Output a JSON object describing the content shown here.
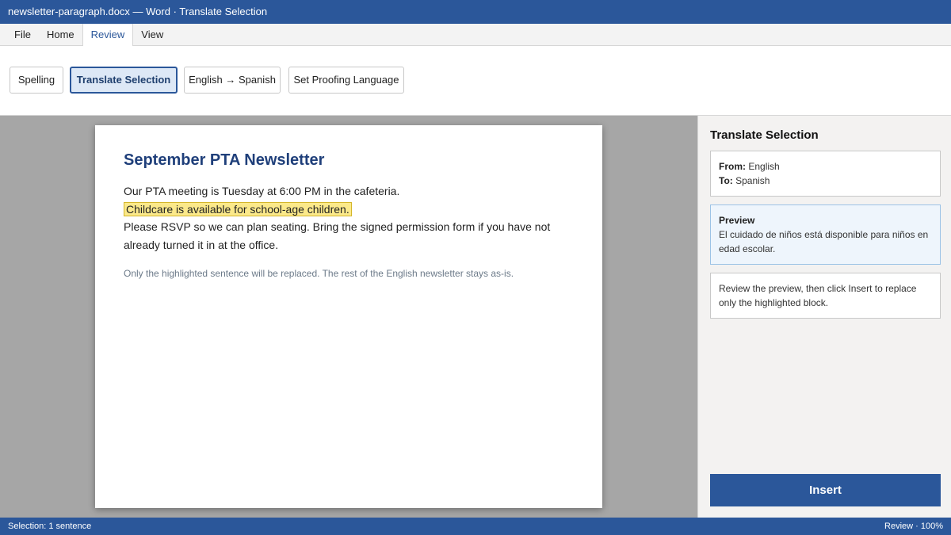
{
  "window": {
    "title": "newsletter-paragraph.docx — Word · Translate Selection"
  },
  "menu": {
    "tabs": [
      {
        "label": "File"
      },
      {
        "label": "Home"
      },
      {
        "label": "Review",
        "active": true
      },
      {
        "label": "View"
      }
    ]
  },
  "ribbon": {
    "spelling": "Spelling",
    "translate_selection": "Translate Selection",
    "language_pair": "English → Spanish",
    "set_proofing": "Set Proofing Language"
  },
  "document": {
    "title": "September PTA Newsletter",
    "line1": "Our PTA meeting is Tuesday at 6:00 PM in the cafeteria.",
    "highlighted": "Childcare is available for school-age children.",
    "line3": "Please RSVP so we can plan seating. Bring the signed permission form if you have not already turned it in at the office.",
    "note": "Only the highlighted sentence will be replaced. The rest of the English newsletter stays as-is."
  },
  "panel": {
    "title": "Translate Selection",
    "from_label": "From:",
    "from_value": "English",
    "to_label": "To:",
    "to_value": "Spanish",
    "preview_label": "Preview",
    "preview_text": "El cuidado de niños está disponible para niños en edad escolar.",
    "instructions": "Review the preview, then click Insert to replace only the highlighted block.",
    "insert_label": "Insert"
  },
  "status": {
    "left": "Selection: 1 sentence",
    "right": "Review · 100%"
  },
  "colors": {
    "accent": "#2b579a",
    "highlight": "#fbe98a",
    "title_blue": "#1f3f7a"
  }
}
